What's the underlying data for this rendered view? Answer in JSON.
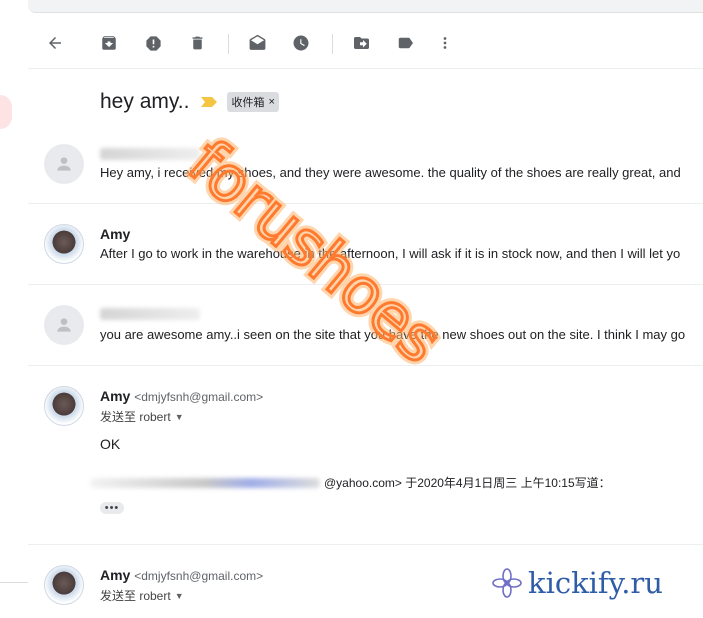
{
  "toolbar": {
    "buttons": [
      "back-icon",
      "archive-icon",
      "report-spam-icon",
      "delete-icon",
      "mark-unread-icon",
      "snooze-icon",
      "move-to-icon",
      "label-icon",
      "more-icon"
    ]
  },
  "thread": {
    "subject": "hey amy..",
    "label": "收件箱"
  },
  "messages": [
    {
      "sender": "robert",
      "snippet": "Hey amy, i received my shoes, and they were awesome. the quality of the shoes are really great, and"
    },
    {
      "sender": "Amy",
      "snippet": "After I go to work in the warehouse in the afternoon, I will ask if it is in stock now, and then I will let yo"
    },
    {
      "sender": "robert",
      "snippet": "you are awesome amy..i seen on the site that you have the new shoes out on the site. I think I may go"
    },
    {
      "sender": "Amy",
      "email": "<dmjyfsnh@gmail.com>",
      "to": "发送至 robert",
      "body": "OK",
      "quote_tail": "@yahoo.com> 于2020年4月1日周三 上午10:15写道："
    },
    {
      "sender": "Amy",
      "email": "<dmjyfsnh@gmail.com>",
      "to": "发送至 robert"
    }
  ],
  "watermark": {
    "text": "forushoes",
    "brand": "kickify.ru"
  },
  "colors": {
    "accent": "#1a73e8",
    "importance": "#f4c542",
    "watermark": "#ff7a2e",
    "brand": "#2f5ca8"
  }
}
